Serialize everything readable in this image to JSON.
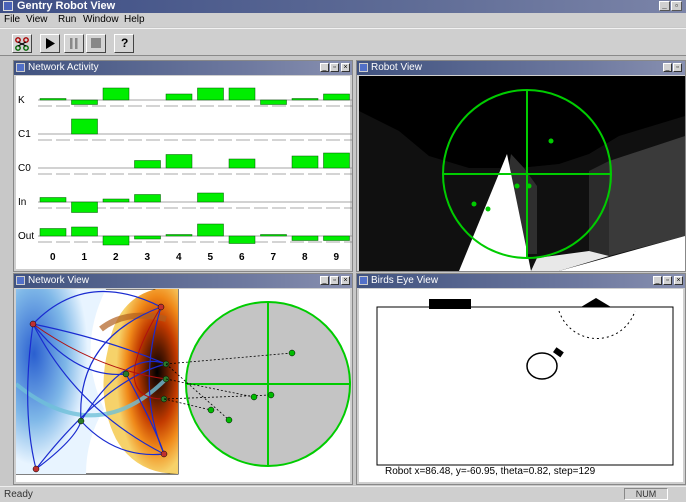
{
  "app": {
    "title": "Gentry Robot View",
    "menu": [
      "File",
      "View",
      "Run",
      "Window",
      "Help"
    ],
    "toolbar": [
      {
        "name": "network-tool-button",
        "icon": "network-icon"
      },
      {
        "name": "run-button",
        "icon": "play-icon"
      },
      {
        "name": "pause-button",
        "icon": "pause-icon"
      },
      {
        "name": "stop-button",
        "icon": "stop-icon"
      },
      {
        "name": "help-button",
        "icon": "help-icon",
        "label": "?"
      }
    ]
  },
  "windows": {
    "network_activity": {
      "title": "Network Activity",
      "rows": [
        "K",
        "C1",
        "C0",
        "In",
        "Out"
      ],
      "columns": [
        "0",
        "1",
        "2",
        "3",
        "4",
        "5",
        "6",
        "7",
        "8",
        "9"
      ],
      "values": {
        "K": [
          0.1,
          -0.3,
          0.8,
          0.0,
          0.4,
          0.8,
          0.8,
          -0.3,
          0.1,
          0.4
        ],
        "C1": [
          0.0,
          1.0,
          0.0,
          0.0,
          0.0,
          0.0,
          0.0,
          0.0,
          0.0,
          0.0
        ],
        "C0": [
          0.0,
          0.0,
          0.0,
          0.5,
          0.9,
          0.0,
          0.6,
          0.0,
          0.8,
          1.0
        ],
        "In": [
          0.3,
          -0.7,
          0.2,
          0.5,
          0.0,
          0.6,
          0.0,
          0.0,
          0.0,
          0.0
        ],
        "Out": [
          0.5,
          0.6,
          -0.6,
          -0.2,
          0.1,
          0.8,
          -0.5,
          0.1,
          -0.3,
          -0.3
        ]
      },
      "bar_color": "#00ee00"
    },
    "robot_view": {
      "title": "Robot View",
      "accent": "#00cc00"
    },
    "network_view": {
      "title": "Network View"
    },
    "birds_eye_view": {
      "title": "Birds Eye View",
      "readout": "Robot x=86.48, y=-60.95, theta=0.82, step=129"
    }
  },
  "status": {
    "text": "Ready",
    "indicator": "NUM"
  }
}
